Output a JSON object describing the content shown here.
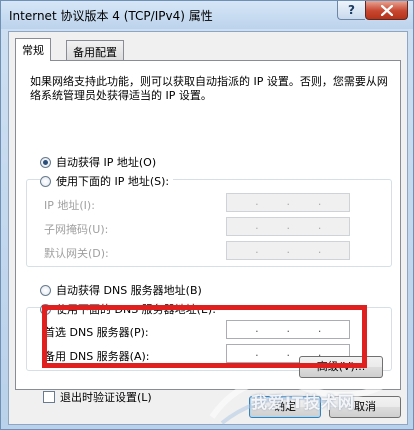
{
  "window": {
    "title": "Internet 协议版本 4 (TCP/IPv4) 属性",
    "help_label": "?"
  },
  "tabs": [
    {
      "label": "常规",
      "active": true
    },
    {
      "label": "备用配置",
      "active": false
    }
  ],
  "description": "如果网络支持此功能，则可以获取自动指派的 IP 设置。否则，您需要从网络系统管理员处获得适当的 IP 设置。",
  "ip": {
    "auto_label": "自动获得 IP 地址(O)",
    "auto_checked": true,
    "manual_label": "使用下面的 IP 地址(S):",
    "manual_checked": false,
    "fields": [
      {
        "label": "IP 地址(I):",
        "value": ". . ."
      },
      {
        "label": "子网掩码(U):",
        "value": ". . ."
      },
      {
        "label": "默认网关(D):",
        "value": ". . ."
      }
    ]
  },
  "dns": {
    "auto_label": "自动获得 DNS 服务器地址(B)",
    "auto_checked": false,
    "manual_label": "使用下面的 DNS 服务器地址(E):",
    "manual_checked": true,
    "fields": [
      {
        "label": "首选 DNS 服务器(P):",
        "value": ". . ."
      },
      {
        "label": "备用 DNS 服务器(A):",
        "value": ". . ."
      }
    ]
  },
  "validate_label": "退出时验证设置(L)",
  "validate_checked": false,
  "buttons": {
    "advanced": "高级(V)...",
    "ok": "确定",
    "cancel": "取消"
  },
  "watermark": "我爱IT技术网",
  "colors": {
    "highlight": "#e0201f",
    "close_button": "#c7462f"
  }
}
